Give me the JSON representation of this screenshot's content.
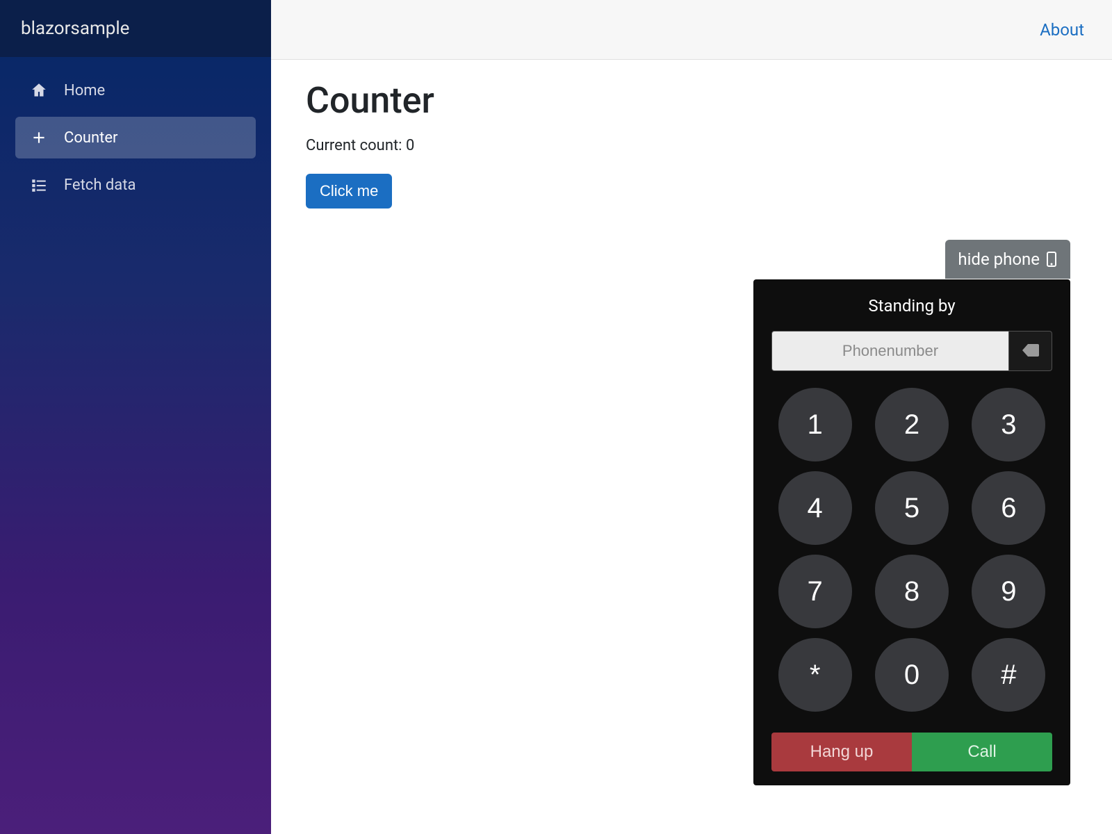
{
  "brand": "blazorsample",
  "sidebar": {
    "items": [
      {
        "label": "Home"
      },
      {
        "label": "Counter"
      },
      {
        "label": "Fetch data"
      }
    ]
  },
  "topbar": {
    "about": "About"
  },
  "page": {
    "title": "Counter",
    "count_label": "Current count: 0",
    "button": "Click me"
  },
  "phone": {
    "hide_label": "hide phone",
    "status": "Standing by",
    "placeholder": "Phonenumber",
    "keys": [
      "1",
      "2",
      "3",
      "4",
      "5",
      "6",
      "7",
      "8",
      "9",
      "*",
      "0",
      "#"
    ],
    "hangup": "Hang up",
    "call": "Call"
  }
}
